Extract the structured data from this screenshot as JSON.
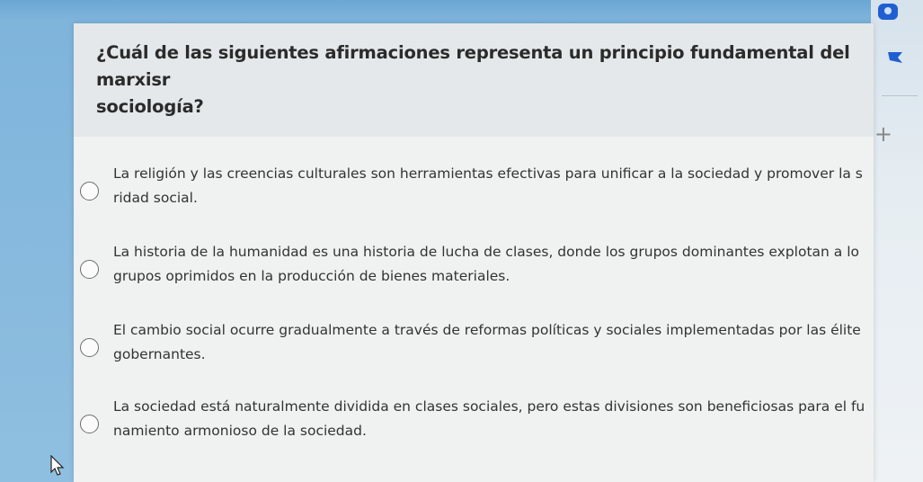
{
  "question": {
    "line1": "¿Cuál de las siguientes afirmaciones representa un principio fundamental del marxisr",
    "line2": "sociología?"
  },
  "options": [
    {
      "line1": "La religión y las creencias culturales son herramientas efectivas para unificar a la sociedad y promover la s",
      "line2": "ridad social.",
      "selected": false
    },
    {
      "line1": "La historia de la humanidad es una historia de lucha de clases, donde los grupos dominantes explotan a lo",
      "line2": "grupos oprimidos en la producción de bienes materiales.",
      "selected": false
    },
    {
      "line1": "El cambio social ocurre gradualmente a través de reformas políticas y sociales implementadas por las élite",
      "line2": "gobernantes.",
      "selected": false
    },
    {
      "line1": "La sociedad está naturalmente dividida en clases sociales, pero estas divisiones son beneficiosas para el fu",
      "line2": "namiento armonioso de la sociedad.",
      "selected": false
    }
  ],
  "side_toolbar": {
    "top_icon": "app-icon",
    "flag_icon": "flag-icon",
    "plus_icon": "plus-icon",
    "plus_glyph": "+"
  },
  "colors": {
    "accent": "#1f5fd1",
    "background": "#7fb4db",
    "card": "#f0f1f1"
  }
}
